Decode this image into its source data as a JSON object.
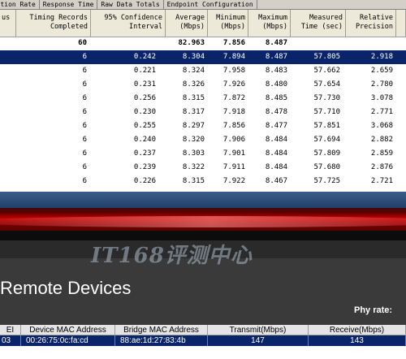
{
  "tabs": [
    "saction Rate",
    "Response Time",
    "Raw Data Totals",
    "Endpoint Configuration"
  ],
  "columns": [
    {
      "key": "status",
      "label": "us"
    },
    {
      "key": "records",
      "label": "Timing Records Completed"
    },
    {
      "key": "conf",
      "label": "95% Confidence Interval"
    },
    {
      "key": "avg",
      "label": "Average (Mbps)"
    },
    {
      "key": "min",
      "label": "Minimum (Mbps)"
    },
    {
      "key": "max",
      "label": "Maximum (Mbps)"
    },
    {
      "key": "time",
      "label": "Measured Time (sec)"
    },
    {
      "key": "prec",
      "label": "Relative Precision"
    }
  ],
  "totals": {
    "records": "60",
    "avg": "82.963",
    "min": "7.856",
    "max": "8.487"
  },
  "rows": [
    {
      "records": "6",
      "conf": "0.242",
      "avg": "8.304",
      "min": "7.894",
      "max": "8.487",
      "time": "57.805",
      "prec": "2.918"
    },
    {
      "records": "6",
      "conf": "0.221",
      "avg": "8.324",
      "min": "7.958",
      "max": "8.483",
      "time": "57.662",
      "prec": "2.659"
    },
    {
      "records": "6",
      "conf": "0.231",
      "avg": "8.326",
      "min": "7.926",
      "max": "8.480",
      "time": "57.654",
      "prec": "2.780"
    },
    {
      "records": "6",
      "conf": "0.256",
      "avg": "8.315",
      "min": "7.872",
      "max": "8.485",
      "time": "57.730",
      "prec": "3.078"
    },
    {
      "records": "6",
      "conf": "0.230",
      "avg": "8.317",
      "min": "7.918",
      "max": "8.478",
      "time": "57.710",
      "prec": "2.771"
    },
    {
      "records": "6",
      "conf": "0.255",
      "avg": "8.297",
      "min": "7.856",
      "max": "8.477",
      "time": "57.851",
      "prec": "3.068"
    },
    {
      "records": "6",
      "conf": "0.240",
      "avg": "8.320",
      "min": "7.906",
      "max": "8.484",
      "time": "57.694",
      "prec": "2.882"
    },
    {
      "records": "6",
      "conf": "0.237",
      "avg": "8.303",
      "min": "7.901",
      "max": "8.484",
      "time": "57.809",
      "prec": "2.859"
    },
    {
      "records": "6",
      "conf": "0.239",
      "avg": "8.322",
      "min": "7.911",
      "max": "8.484",
      "time": "57.680",
      "prec": "2.876"
    },
    {
      "records": "6",
      "conf": "0.226",
      "avg": "8.315",
      "min": "7.922",
      "max": "8.467",
      "time": "57.725",
      "prec": "2.721"
    }
  ],
  "selected_row": 0,
  "watermark": "IT168评测中心",
  "watermark_corner": "AP",
  "devices": {
    "title": "Remote Devices",
    "phy_rate_label": "Phy rate:",
    "headers": [
      "EI",
      "Device MAC Address",
      "Bridge MAC Address",
      "Transmit(Mbps)",
      "Receive(Mbps)"
    ],
    "rows": [
      {
        "ei": "03",
        "device_mac": "00:26:75:0c:fa:cd",
        "bridge_mac": "88:ae:1d:27:83:4b",
        "transmit": "147",
        "receive": "143"
      }
    ]
  },
  "colors": {
    "selection": "#0a246a",
    "banner_red": "#c00000",
    "panel_bg": "#3a3a3a"
  }
}
